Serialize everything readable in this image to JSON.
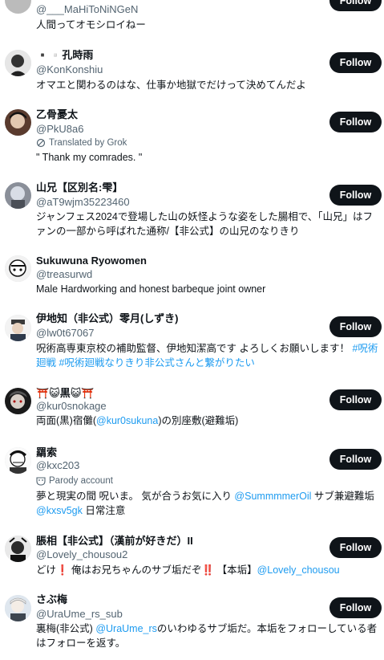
{
  "follow_label": "Follow",
  "users": [
    {
      "name": "",
      "handle": "@___MaHiToNiNGeN",
      "bio": [
        {
          "t": "人間ってオモシロイねー"
        }
      ]
    },
    {
      "name": "▪️▫️孔時雨",
      "handle": "@KonKonshiu",
      "bio": [
        {
          "t": "オマエと関わるのはな、仕事か地獄でだけって決めてんだよ"
        }
      ]
    },
    {
      "name": "乙骨憂太",
      "handle": "@PkU8a6",
      "translated": "Translated by Grok",
      "bio": [
        {
          "t": "\" Thank my comrades. \""
        }
      ]
    },
    {
      "name": "山兄【区別名:雫】",
      "handle": "@aT9wjm35223460",
      "bio": [
        {
          "t": "ジャンフェス2024で登場した山の妖怪ような姿をした腸相で、「山兄」はファンの一部から呼ばれた通称/【非公式】の山兄のなりきり"
        }
      ]
    },
    {
      "name": "Sukuwuna Ryowomen",
      "handle": "@treasurwd",
      "bio": [
        {
          "t": "Male Hardworking and honest barbeque joint owner"
        }
      ]
    },
    {
      "name": "伊地知（非公式）零月(しずき)",
      "handle": "@lw0t67067",
      "bio": [
        {
          "t": "呪術高専東京校の補助監督、伊地知潔高です よろしくお願いします！"
        },
        {
          "t": " #呪術廻戦 #呪術廻戦なりきり非公式さんと繋がりたい",
          "link": true
        }
      ]
    },
    {
      "name": "⛩️😺黒😺⛩️",
      "handle": "@kur0snokage",
      "bio": [
        {
          "t": "両面(黒)宿儺("
        },
        {
          "t": "@kur0sukuna",
          "link": true
        },
        {
          "t": ")の別座敷(避難垢)"
        }
      ]
    },
    {
      "name": "羂索",
      "handle": "@kxc203",
      "parody": "Parody account",
      "bio": [
        {
          "t": "夢と現実の間 呪いま。 気が合うお気に入り "
        },
        {
          "t": "@SummmmerOil",
          "link": true
        },
        {
          "t": " サブ兼避難垢 "
        },
        {
          "t": "@kxsv5gk",
          "link": true
        },
        {
          "t": " 日常注意"
        }
      ]
    },
    {
      "name": "脹相【非公式】（漢前が好きだ）II",
      "handle": "@Lovely_chousou2",
      "bio": [
        {
          "t": "どけ❗ 俺はお兄ちゃんのサブ垢だぞ‼️ 【本垢】"
        },
        {
          "t": "@Lovely_chousou",
          "link": true
        }
      ]
    },
    {
      "name": "さぶ梅",
      "handle": "@UraUme_rs_sub",
      "bio": [
        {
          "t": "裏梅(非公式) "
        },
        {
          "t": "@UraUme_rs",
          "link": true
        },
        {
          "t": "のいわゆるサブ垢だ。本垢をフォローしている者はフォローを返す。"
        }
      ]
    }
  ]
}
